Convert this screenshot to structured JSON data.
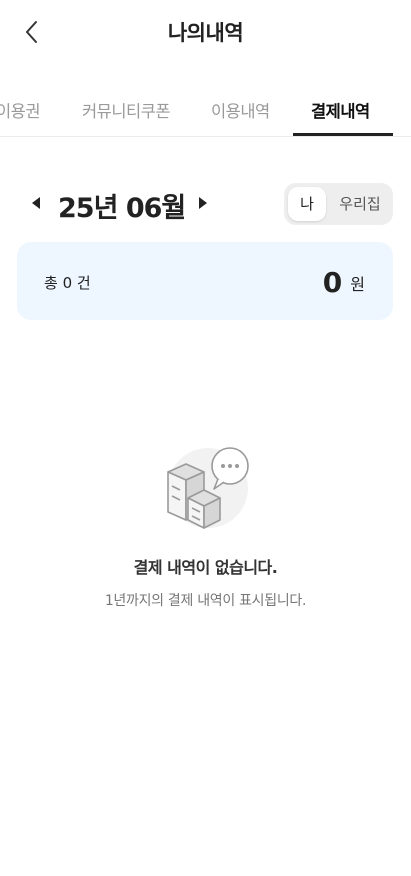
{
  "header": {
    "title": "나의내역"
  },
  "tabs": [
    {
      "label": "이용권",
      "active": false
    },
    {
      "label": "커뮤니티쿠폰",
      "active": false
    },
    {
      "label": "이용내역",
      "active": false
    },
    {
      "label": "결제내역",
      "active": true
    }
  ],
  "month": {
    "label": "25년 06월"
  },
  "owner_toggle": {
    "options": [
      "나",
      "우리집"
    ],
    "selected": "나"
  },
  "summary": {
    "count_label": "총 0 건",
    "amount": "0",
    "currency": "원"
  },
  "empty": {
    "title": "결제 내역이 없습니다.",
    "subtitle": "1년까지의 결제 내역이 표시됩니다."
  },
  "colors": {
    "accent_bg": "#eef6ff",
    "active_tab": "#222222",
    "inactive_tab": "#9a9a9a"
  },
  "icons": [
    "back-chevron-icon",
    "prev-month-icon",
    "next-month-icon",
    "empty-receipt-illustration"
  ]
}
